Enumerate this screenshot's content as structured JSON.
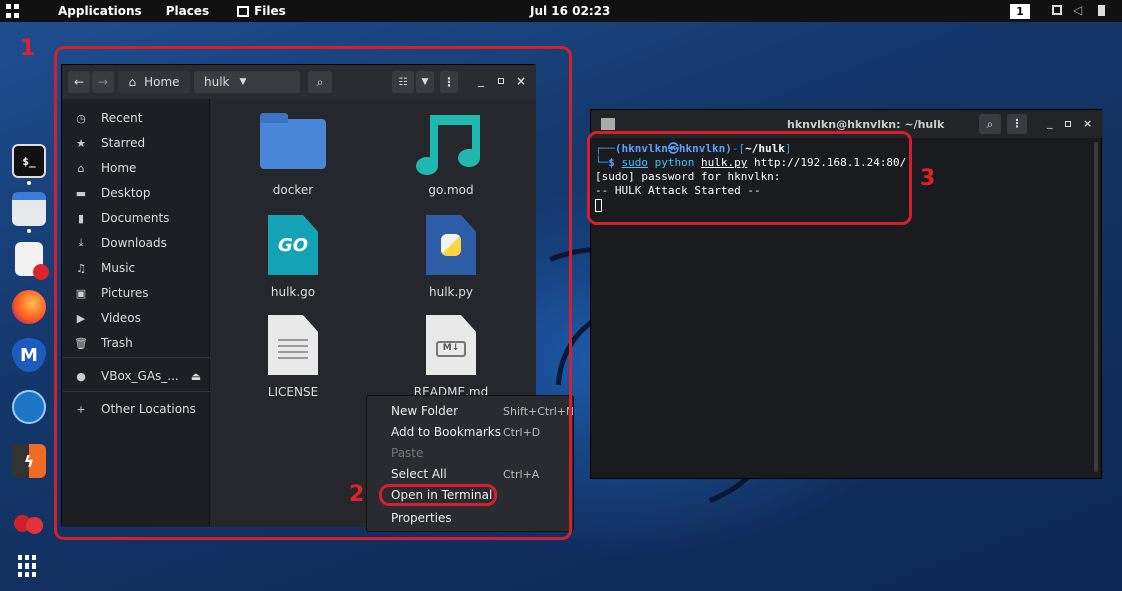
{
  "topbar": {
    "apps": "Applications",
    "places": "Places",
    "files": "Files",
    "clock": "Jul 16 02:23",
    "workspace": "1"
  },
  "annotations": {
    "n1": "1",
    "n2": "2",
    "n3": "3"
  },
  "dock": {
    "icons": [
      "terminal-icon",
      "files-icon",
      "text-editor-icon",
      "firefox-icon",
      "metasploit-icon",
      "wireshark-icon",
      "burpsuite-icon",
      "cherrytree-icon",
      "show-apps-icon"
    ],
    "terminal_label": "$_"
  },
  "files_window": {
    "breadcrumb_home": "Home",
    "breadcrumb_folder": "hulk",
    "sidebar": [
      {
        "icon": "clock-icon",
        "label": "Recent"
      },
      {
        "icon": "star-icon",
        "label": "Starred"
      },
      {
        "icon": "home-icon",
        "label": "Home"
      },
      {
        "icon": "desktop-icon",
        "label": "Desktop"
      },
      {
        "icon": "document-icon",
        "label": "Documents"
      },
      {
        "icon": "download-icon",
        "label": "Downloads"
      },
      {
        "icon": "music-icon",
        "label": "Music"
      },
      {
        "icon": "pictures-icon",
        "label": "Pictures"
      },
      {
        "icon": "video-icon",
        "label": "Videos"
      },
      {
        "icon": "trash-icon",
        "label": "Trash"
      },
      {
        "icon": "disc-icon",
        "label": "VBox_GAs_..."
      },
      {
        "icon": "plus-icon",
        "label": "Other Locations"
      }
    ],
    "files": [
      {
        "name": "docker",
        "type": "folder"
      },
      {
        "name": "go.mod",
        "type": "music"
      },
      {
        "name": "hulk.go",
        "type": "go"
      },
      {
        "name": "hulk.py",
        "type": "python"
      },
      {
        "name": "LICENSE",
        "type": "text"
      },
      {
        "name": "README.md",
        "type": "markdown"
      }
    ],
    "context_menu": [
      {
        "label": "New Folder",
        "shortcut": "Shift+Ctrl+N",
        "disabled": false
      },
      {
        "label": "Add to Bookmarks",
        "shortcut": "Ctrl+D",
        "disabled": false
      },
      {
        "label": "Paste",
        "shortcut": "",
        "disabled": true
      },
      {
        "label": "Select All",
        "shortcut": "Ctrl+A",
        "disabled": false
      },
      {
        "label": "Open in Terminal",
        "shortcut": "",
        "disabled": false
      },
      {
        "label": "Properties",
        "shortcut": "",
        "disabled": false
      }
    ]
  },
  "terminal": {
    "title": "hknvlkn@hknvlkn: ~/hulk",
    "prompt_user": "(hknvlkn㉿hknvlkn)",
    "prompt_dir": "~/hulk",
    "command_sudo": "sudo",
    "command_python": "python",
    "command_file": "hulk.py",
    "command_url": "http://192.168.1.24:80/",
    "line2": "[sudo] password for hknvlkn:",
    "line3": "-- HULK Attack Started --"
  }
}
